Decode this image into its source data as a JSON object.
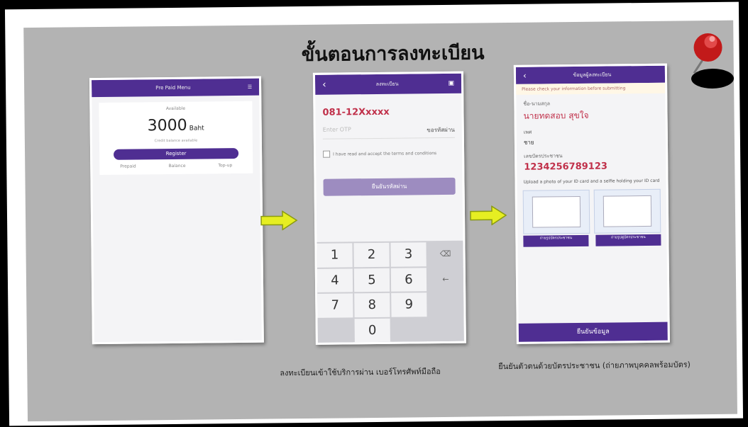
{
  "title": "ขั้นตอนการลงทะเบียน",
  "screens": {
    "screen1": {
      "header": "Pre Paid Menu",
      "card_label": "Available",
      "amount": "3000",
      "amount_unit": "Baht",
      "sub_text": "Credit balance available",
      "button": "Register",
      "row": [
        "Prepaid",
        "Balance",
        "Top-up"
      ]
    },
    "screen2": {
      "header": "ลงทะเบียน",
      "phone_number": "081-12Xxxxx",
      "otp_hint": "Enter OTP",
      "otp_action": "ขอรหัสผ่าน",
      "terms": "I have read and accept the terms and conditions",
      "submit": "ยืนยันรหัสผ่าน",
      "keys": [
        "1",
        "2",
        "3",
        "⌫",
        "4",
        "5",
        "6",
        "←",
        "7",
        "8",
        "9",
        "",
        "",
        "0",
        "",
        ""
      ]
    },
    "screen3": {
      "header": "ข้อมูลผู้ลงทะเบียน",
      "notice": "Please check your information before submitting",
      "name_label": "ชื่อ-นามสกุล",
      "name_value": "นายทดสอบ สุขใจ",
      "gender_label": "เพศ",
      "gender_value": "ชาย",
      "id_label": "เลขบัตรประชาชน",
      "id_value": "1234256789123",
      "photo_caption": "Upload a photo of your ID card and a selfie holding your ID card",
      "photo_btn_1": "ถ่ายรูปบัตรประชาชน",
      "photo_btn_2": "ถ่ายรูปคู่บัตรประชาชน",
      "bottom_button": "ยืนยันข้อมูล"
    }
  },
  "captions": {
    "caption1": "ลงทะเบียนเข้าใช้บริการผ่าน เบอร์โทรศัพท์มือถือ",
    "caption2": "ยืนยันตัวตนด้วยบัตรประชาชน (ถ่ายภาพบุคคลพร้อมบัตร)"
  }
}
